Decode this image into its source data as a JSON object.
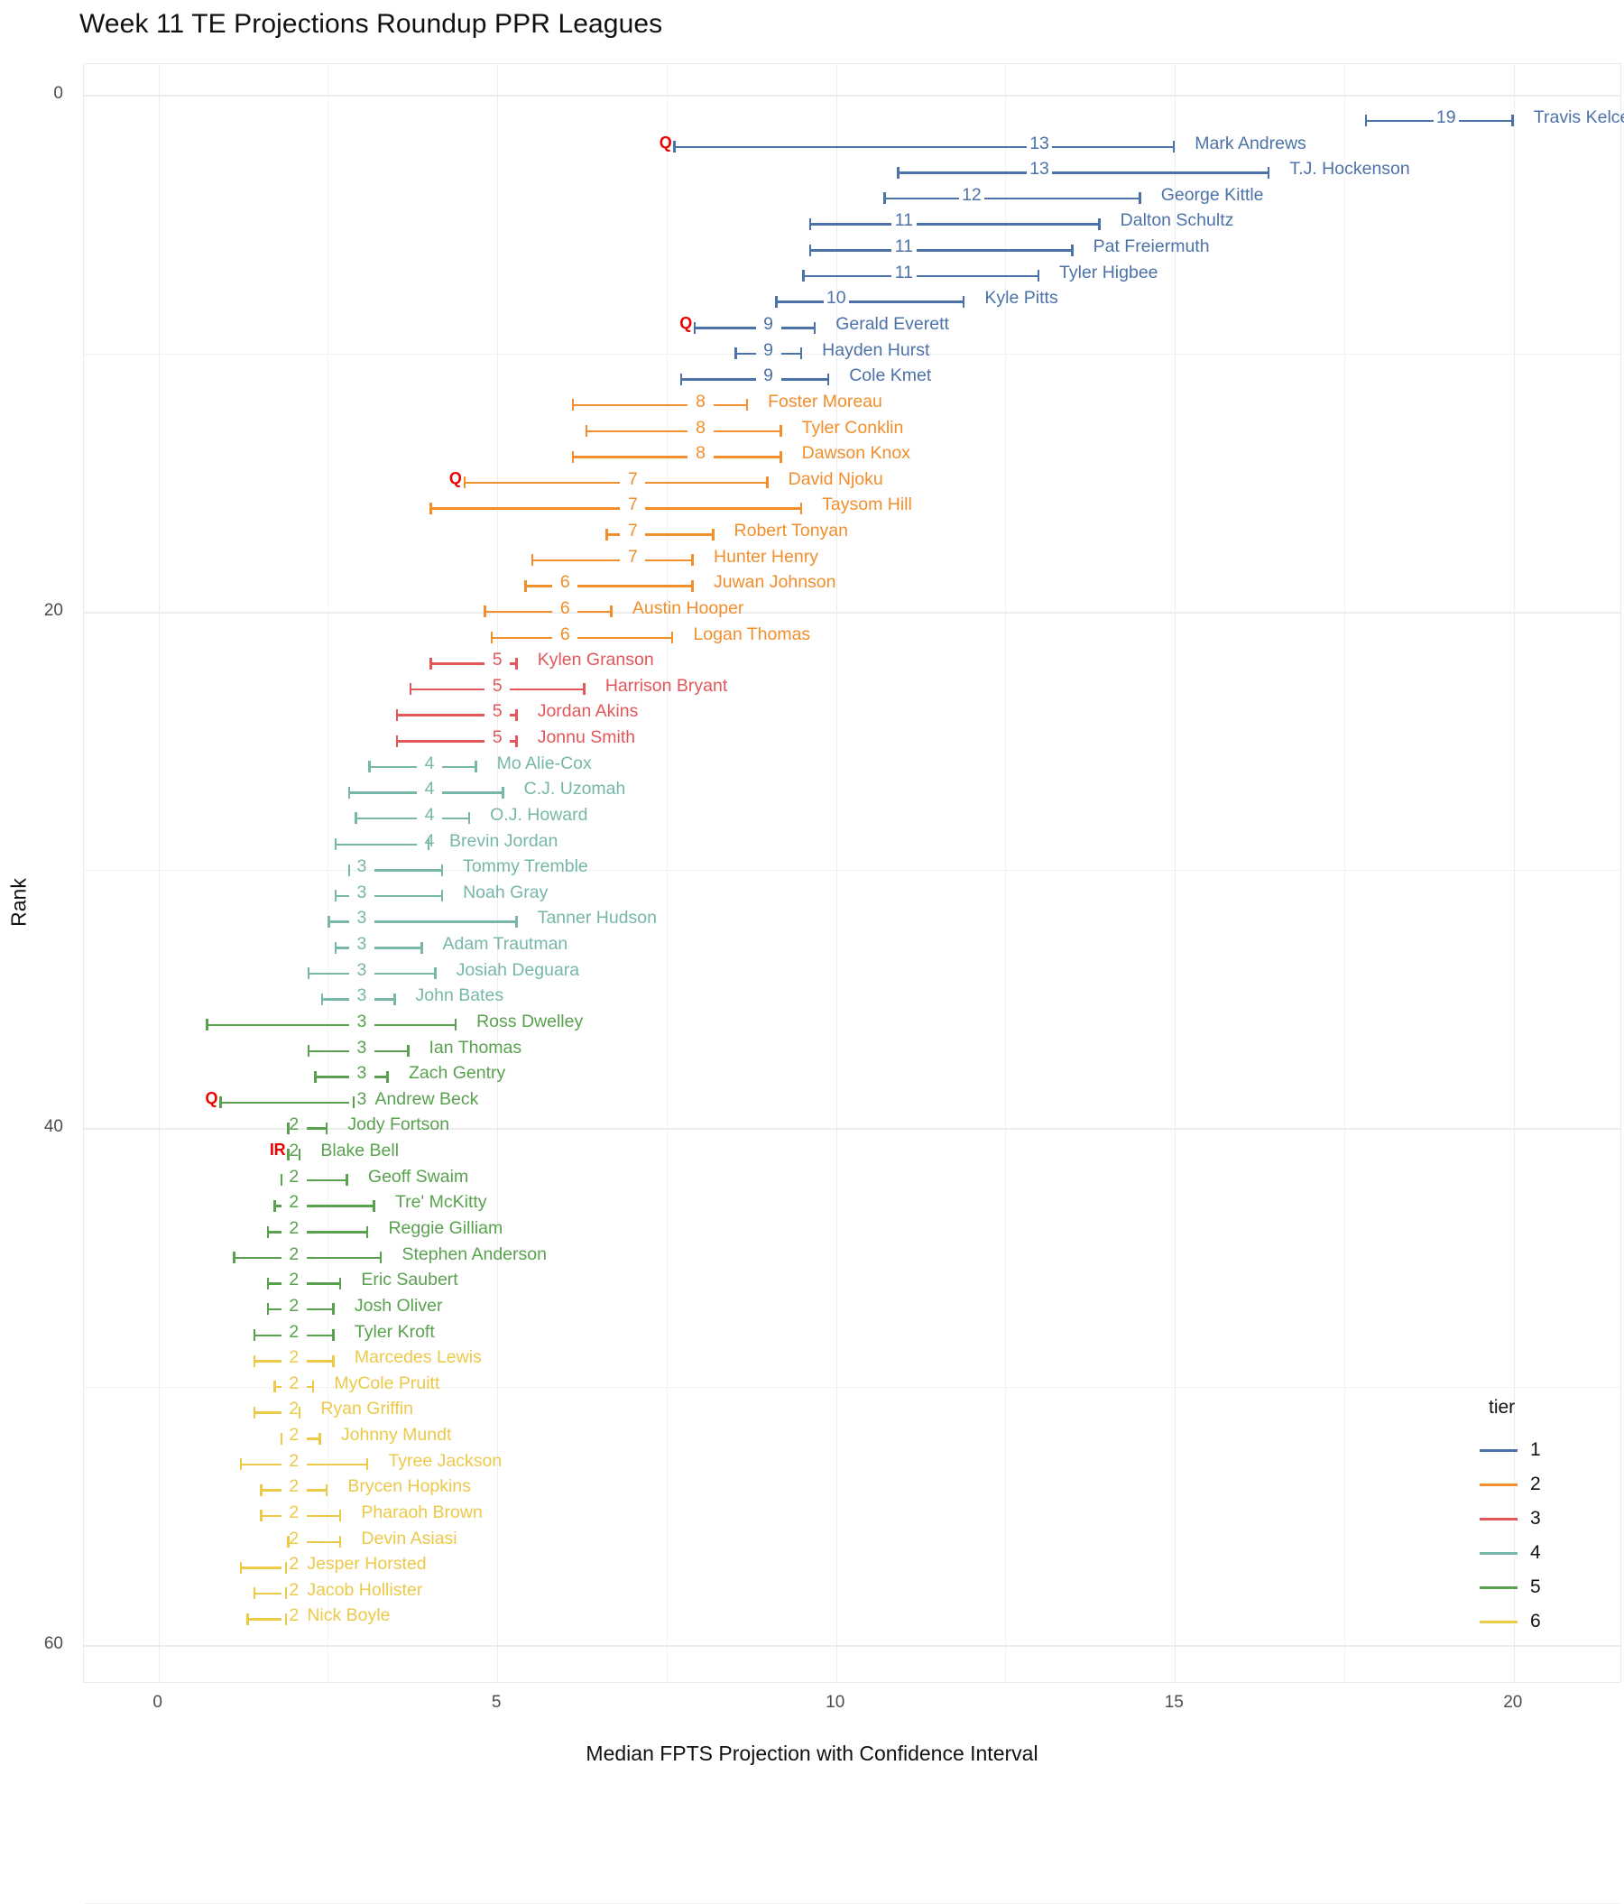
{
  "title": "Week 11 TE Projections Roundup PPR Leagues",
  "axes": {
    "x_title": "Median FPTS Projection with Confidence Interval",
    "y_title": "Rank",
    "x_ticks": [
      0,
      5,
      10,
      15,
      20
    ],
    "y_ticks": [
      0,
      20,
      40,
      60
    ],
    "xlim": [
      -1.1,
      21.6
    ],
    "ylim": [
      -1.2,
      61.5
    ]
  },
  "legend": {
    "title": "tier",
    "items": [
      {
        "label": "1",
        "color": "#4c72a8"
      },
      {
        "label": "2",
        "color": "#f28e2b"
      },
      {
        "label": "3",
        "color": "#e15759"
      },
      {
        "label": "4",
        "color": "#76b7a8"
      },
      {
        "label": "5",
        "color": "#59a14f"
      },
      {
        "label": "6",
        "color": "#edc948"
      }
    ]
  },
  "tier_colors": {
    "1": "#4c72a8",
    "2": "#f28e2b",
    "3": "#e15759",
    "4": "#76b7a8",
    "5": "#59a14f",
    "6": "#edc948"
  },
  "chart_data": {
    "type": "line",
    "title": "Week 11 TE Projections Roundup PPR Leagues",
    "xlabel": "Median FPTS Projection with Confidence Interval",
    "ylabel": "Rank",
    "grid": true,
    "legend_position": "right",
    "xlim": [
      -1.1,
      21.6
    ],
    "ylim": [
      -1.2,
      61.5
    ],
    "players": [
      {
        "rank": 1,
        "name": "Travis Kelce",
        "median": 19,
        "low": 17.8,
        "high": 20.0,
        "tier": 1,
        "status": ""
      },
      {
        "rank": 2,
        "name": "Mark Andrews",
        "median": 13,
        "low": 7.6,
        "high": 15.0,
        "tier": 1,
        "status": "Q"
      },
      {
        "rank": 3,
        "name": "T.J. Hockenson",
        "median": 13,
        "low": 10.9,
        "high": 16.4,
        "tier": 1,
        "status": ""
      },
      {
        "rank": 4,
        "name": "George Kittle",
        "median": 12,
        "low": 10.7,
        "high": 14.5,
        "tier": 1,
        "status": ""
      },
      {
        "rank": 5,
        "name": "Dalton Schultz",
        "median": 11,
        "low": 9.6,
        "high": 13.9,
        "tier": 1,
        "status": ""
      },
      {
        "rank": 6,
        "name": "Pat Freiermuth",
        "median": 11,
        "low": 9.6,
        "high": 13.5,
        "tier": 1,
        "status": ""
      },
      {
        "rank": 7,
        "name": "Tyler Higbee",
        "median": 11,
        "low": 9.5,
        "high": 13.0,
        "tier": 1,
        "status": ""
      },
      {
        "rank": 8,
        "name": "Kyle Pitts",
        "median": 10,
        "low": 9.1,
        "high": 11.9,
        "tier": 1,
        "status": ""
      },
      {
        "rank": 9,
        "name": "Gerald Everett",
        "median": 9,
        "low": 7.9,
        "high": 9.7,
        "tier": 1,
        "status": "Q"
      },
      {
        "rank": 10,
        "name": "Hayden Hurst",
        "median": 9,
        "low": 8.5,
        "high": 9.5,
        "tier": 1,
        "status": ""
      },
      {
        "rank": 11,
        "name": "Cole Kmet",
        "median": 9,
        "low": 7.7,
        "high": 9.9,
        "tier": 1,
        "status": ""
      },
      {
        "rank": 12,
        "name": "Foster Moreau",
        "median": 8,
        "low": 6.1,
        "high": 8.7,
        "tier": 2,
        "status": ""
      },
      {
        "rank": 13,
        "name": "Tyler Conklin",
        "median": 8,
        "low": 6.3,
        "high": 9.2,
        "tier": 2,
        "status": ""
      },
      {
        "rank": 14,
        "name": "Dawson Knox",
        "median": 8,
        "low": 6.1,
        "high": 9.2,
        "tier": 2,
        "status": ""
      },
      {
        "rank": 15,
        "name": "David Njoku",
        "median": 7,
        "low": 4.5,
        "high": 9.0,
        "tier": 2,
        "status": "Q"
      },
      {
        "rank": 16,
        "name": "Taysom Hill",
        "median": 7,
        "low": 4.0,
        "high": 9.5,
        "tier": 2,
        "status": ""
      },
      {
        "rank": 17,
        "name": "Robert Tonyan",
        "median": 7,
        "low": 6.6,
        "high": 8.2,
        "tier": 2,
        "status": ""
      },
      {
        "rank": 18,
        "name": "Hunter Henry",
        "median": 7,
        "low": 5.5,
        "high": 7.9,
        "tier": 2,
        "status": ""
      },
      {
        "rank": 19,
        "name": "Juwan Johnson",
        "median": 6,
        "low": 5.4,
        "high": 7.9,
        "tier": 2,
        "status": ""
      },
      {
        "rank": 20,
        "name": "Austin Hooper",
        "median": 6,
        "low": 4.8,
        "high": 6.7,
        "tier": 2,
        "status": ""
      },
      {
        "rank": 21,
        "name": "Logan Thomas",
        "median": 6,
        "low": 4.9,
        "high": 7.6,
        "tier": 2,
        "status": ""
      },
      {
        "rank": 22,
        "name": "Kylen Granson",
        "median": 5,
        "low": 4.0,
        "high": 5.3,
        "tier": 3,
        "status": ""
      },
      {
        "rank": 23,
        "name": "Harrison Bryant",
        "median": 5,
        "low": 3.7,
        "high": 6.3,
        "tier": 3,
        "status": ""
      },
      {
        "rank": 24,
        "name": "Jordan Akins",
        "median": 5,
        "low": 3.5,
        "high": 5.3,
        "tier": 3,
        "status": ""
      },
      {
        "rank": 25,
        "name": "Jonnu Smith",
        "median": 5,
        "low": 3.5,
        "high": 5.3,
        "tier": 3,
        "status": ""
      },
      {
        "rank": 26,
        "name": "Mo Alie-Cox",
        "median": 4,
        "low": 3.1,
        "high": 4.7,
        "tier": 4,
        "status": ""
      },
      {
        "rank": 27,
        "name": "C.J. Uzomah",
        "median": 4,
        "low": 2.8,
        "high": 5.1,
        "tier": 4,
        "status": ""
      },
      {
        "rank": 28,
        "name": "O.J. Howard",
        "median": 4,
        "low": 2.9,
        "high": 4.6,
        "tier": 4,
        "status": ""
      },
      {
        "rank": 29,
        "name": "Brevin Jordan",
        "median": 4,
        "low": 2.6,
        "high": 4.0,
        "tier": 4,
        "status": ""
      },
      {
        "rank": 30,
        "name": "Tommy Tremble",
        "median": 3,
        "low": 2.8,
        "high": 4.2,
        "tier": 4,
        "status": ""
      },
      {
        "rank": 31,
        "name": "Noah Gray",
        "median": 3,
        "low": 2.6,
        "high": 4.2,
        "tier": 4,
        "status": ""
      },
      {
        "rank": 32,
        "name": "Tanner Hudson",
        "median": 3,
        "low": 2.5,
        "high": 5.3,
        "tier": 4,
        "status": ""
      },
      {
        "rank": 33,
        "name": "Adam Trautman",
        "median": 3,
        "low": 2.6,
        "high": 3.9,
        "tier": 4,
        "status": ""
      },
      {
        "rank": 34,
        "name": "Josiah Deguara",
        "median": 3,
        "low": 2.2,
        "high": 4.1,
        "tier": 4,
        "status": ""
      },
      {
        "rank": 35,
        "name": "John Bates",
        "median": 3,
        "low": 2.4,
        "high": 3.5,
        "tier": 4,
        "status": ""
      },
      {
        "rank": 36,
        "name": "Ross Dwelley",
        "median": 3,
        "low": 0.7,
        "high": 4.4,
        "tier": 5,
        "status": ""
      },
      {
        "rank": 37,
        "name": "Ian Thomas",
        "median": 3,
        "low": 2.2,
        "high": 3.7,
        "tier": 5,
        "status": ""
      },
      {
        "rank": 38,
        "name": "Zach Gentry",
        "median": 3,
        "low": 2.3,
        "high": 3.4,
        "tier": 5,
        "status": ""
      },
      {
        "rank": 39,
        "name": "Andrew Beck",
        "median": 3,
        "low": 0.9,
        "high": 2.9,
        "tier": 5,
        "status": "Q"
      },
      {
        "rank": 40,
        "name": "Jody Fortson",
        "median": 2,
        "low": 1.9,
        "high": 2.5,
        "tier": 5,
        "status": ""
      },
      {
        "rank": 41,
        "name": "Blake Bell",
        "median": 2,
        "low": 1.9,
        "high": 2.1,
        "tier": 5,
        "status": "IR"
      },
      {
        "rank": 42,
        "name": "Geoff Swaim",
        "median": 2,
        "low": 1.8,
        "high": 2.8,
        "tier": 5,
        "status": ""
      },
      {
        "rank": 43,
        "name": "Tre' McKitty",
        "median": 2,
        "low": 1.7,
        "high": 3.2,
        "tier": 5,
        "status": ""
      },
      {
        "rank": 44,
        "name": "Reggie Gilliam",
        "median": 2,
        "low": 1.6,
        "high": 3.1,
        "tier": 5,
        "status": ""
      },
      {
        "rank": 45,
        "name": "Stephen Anderson",
        "median": 2,
        "low": 1.1,
        "high": 3.3,
        "tier": 5,
        "status": ""
      },
      {
        "rank": 46,
        "name": "Eric Saubert",
        "median": 2,
        "low": 1.6,
        "high": 2.7,
        "tier": 5,
        "status": ""
      },
      {
        "rank": 47,
        "name": "Josh Oliver",
        "median": 2,
        "low": 1.6,
        "high": 2.6,
        "tier": 5,
        "status": ""
      },
      {
        "rank": 48,
        "name": "Tyler Kroft",
        "median": 2,
        "low": 1.4,
        "high": 2.6,
        "tier": 5,
        "status": ""
      },
      {
        "rank": 49,
        "name": "Marcedes Lewis",
        "median": 2,
        "low": 1.4,
        "high": 2.6,
        "tier": 6,
        "status": ""
      },
      {
        "rank": 50,
        "name": "MyCole Pruitt",
        "median": 2,
        "low": 1.7,
        "high": 2.3,
        "tier": 6,
        "status": ""
      },
      {
        "rank": 51,
        "name": "Ryan Griffin",
        "median": 2,
        "low": 1.4,
        "high": 2.1,
        "tier": 6,
        "status": ""
      },
      {
        "rank": 52,
        "name": "Johnny Mundt",
        "median": 2,
        "low": 1.8,
        "high": 2.4,
        "tier": 6,
        "status": ""
      },
      {
        "rank": 53,
        "name": "Tyree Jackson",
        "median": 2,
        "low": 1.2,
        "high": 3.1,
        "tier": 6,
        "status": ""
      },
      {
        "rank": 54,
        "name": "Brycen Hopkins",
        "median": 2,
        "low": 1.5,
        "high": 2.5,
        "tier": 6,
        "status": ""
      },
      {
        "rank": 55,
        "name": "Pharaoh Brown",
        "median": 2,
        "low": 1.5,
        "high": 2.7,
        "tier": 6,
        "status": ""
      },
      {
        "rank": 56,
        "name": "Devin Asiasi",
        "median": 2,
        "low": 1.9,
        "high": 2.7,
        "tier": 6,
        "status": ""
      },
      {
        "rank": 57,
        "name": "Jesper Horsted",
        "median": 2,
        "low": 1.2,
        "high": 1.9,
        "tier": 6,
        "status": ""
      },
      {
        "rank": 58,
        "name": "Jacob Hollister",
        "median": 2,
        "low": 1.4,
        "high": 1.9,
        "tier": 6,
        "status": ""
      },
      {
        "rank": 59,
        "name": "Nick Boyle",
        "median": 2,
        "low": 1.3,
        "high": 1.9,
        "tier": 6,
        "status": ""
      }
    ]
  }
}
